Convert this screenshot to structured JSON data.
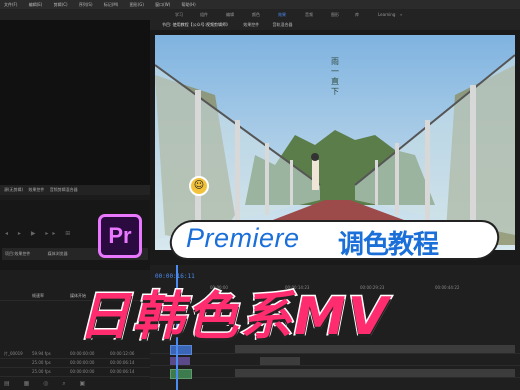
{
  "menu": [
    "文件(F)",
    "编辑(E)",
    "剪辑(C)",
    "序列(S)",
    "标记(M)",
    "图形(G)",
    "窗口(W)",
    "帮助(H)"
  ],
  "workspaces": {
    "items": [
      "学习",
      "组件",
      "编辑",
      "颜色",
      "效果",
      "音频",
      "图形",
      "库",
      "Learning"
    ],
    "active": 4
  },
  "viewer": {
    "tabs": [
      "节目: 使用教程【公众号:视频剪辑师》",
      "效果控件",
      "音轨混合器"
    ]
  },
  "poster": {
    "vertical_text": "雨一直下"
  },
  "source_panel": {
    "tabs": [
      "源(无剪辑)",
      "效果控件",
      "音频剪辑混合器"
    ],
    "lower_tabs": [
      "项目:效果控件",
      "媒体浏览器"
    ]
  },
  "timeline": {
    "timecode": "00:00:16:11",
    "ruler": [
      "00:00:00",
      "00:00:14:23",
      "00:00:29:23",
      "00:00:44:22"
    ]
  },
  "project": {
    "header": [
      "帧速率",
      "媒体开始",
      "媒体结束"
    ],
    "rows": [
      {
        "name": "片_00019",
        "fps": "59.94 fps",
        "start": "00:00:00:00",
        "end": "00:00:12:06"
      },
      {
        "name": "",
        "fps": "25.00 fps",
        "start": "00:00:00:00",
        "end": "00:00:06:14"
      },
      {
        "name": "",
        "fps": "25.00 fps",
        "start": "00:00:00:00",
        "end": "00:00:06:14"
      }
    ]
  },
  "overlay": {
    "logo": "Pr",
    "line1_en": "Premiere",
    "line1_cn": "调色教程",
    "line2": "日韩色系MV"
  },
  "colors": {
    "accent_blue": "#4b8cf2",
    "pr_purple": "#ea77ff",
    "title_pink": "#ff2d6f",
    "title_blue": "#1a6fd8"
  }
}
